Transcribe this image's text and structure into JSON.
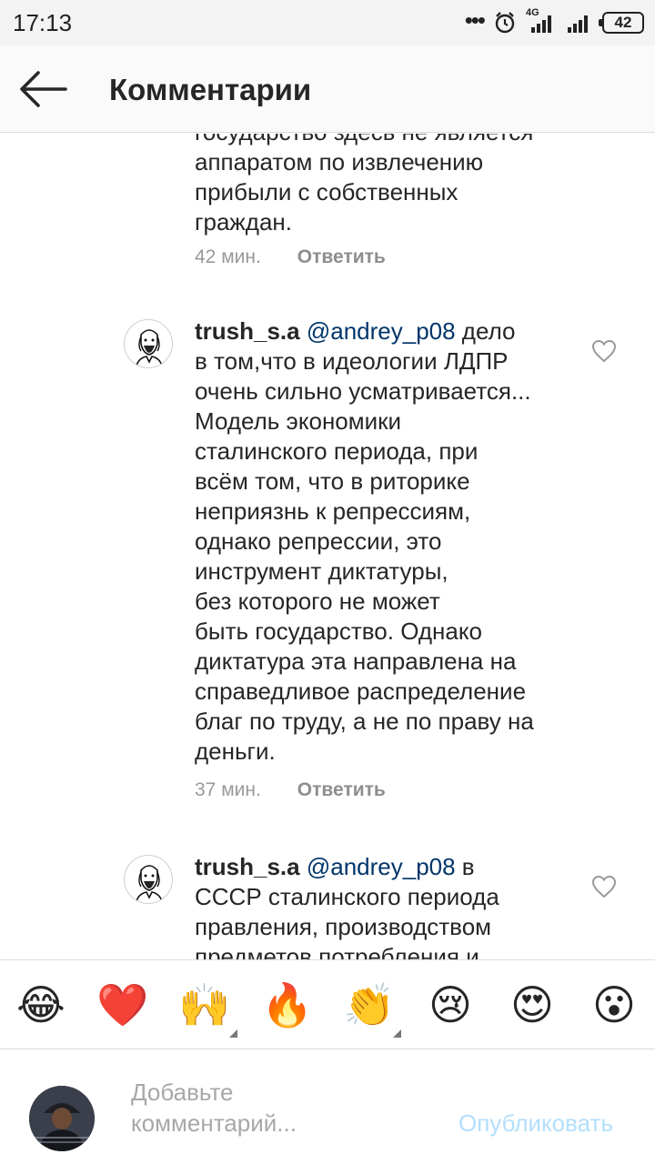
{
  "status_bar": {
    "time": "17:13",
    "network": "4G",
    "battery": "42",
    "icons": [
      "more-dots-icon",
      "alarm-icon",
      "signal-icon",
      "signal-icon",
      "battery-icon"
    ]
  },
  "header": {
    "back_icon": "arrow-left-icon",
    "title": "Комментарии"
  },
  "comments": [
    {
      "cut_text_line": "государство здесь не является",
      "text_lines": [
        "аппаратом по извлечению",
        "прибыли с собственных",
        "граждан."
      ],
      "time": "42 мин.",
      "reply": "Ответить"
    },
    {
      "username": "trush_s.a",
      "mention": "@andrey_p08",
      "first_line_rest": " дело",
      "text_lines": [
        "в том,что в идеологии ЛДПР",
        "очень сильно усматривается...",
        "Модель экономики",
        "сталинского периода, при",
        "всём том, что в риторике",
        "неприязнь к репрессиям,",
        "однако репрессии, это",
        "инструмент диктатуры,",
        "без которого не может",
        "быть государство. Однако",
        "диктатура эта направлена на",
        "справедливое распределение",
        "благ по труду, а не по праву на",
        "деньги."
      ],
      "time": "37 мин.",
      "reply": "Ответить"
    },
    {
      "username": "trush_s.a",
      "mention": "@andrey_p08",
      "first_line_rest": " в",
      "text_lines": [
        "СССР сталинского периода",
        "правления, производством",
        "предметов потребления и"
      ]
    }
  ],
  "emoji_bar": {
    "emojis": [
      "😂",
      "❤️",
      "🙌",
      "🔥",
      "👏",
      "😢",
      "😍",
      "😮"
    ]
  },
  "input": {
    "placeholder_line1": "Добавьте",
    "placeholder_line2": "комментарий...",
    "publish_label": "Опубликовать"
  },
  "colors": {
    "mention": "#003569",
    "publish_disabled": "#b2dffc",
    "meta": "#999999"
  }
}
